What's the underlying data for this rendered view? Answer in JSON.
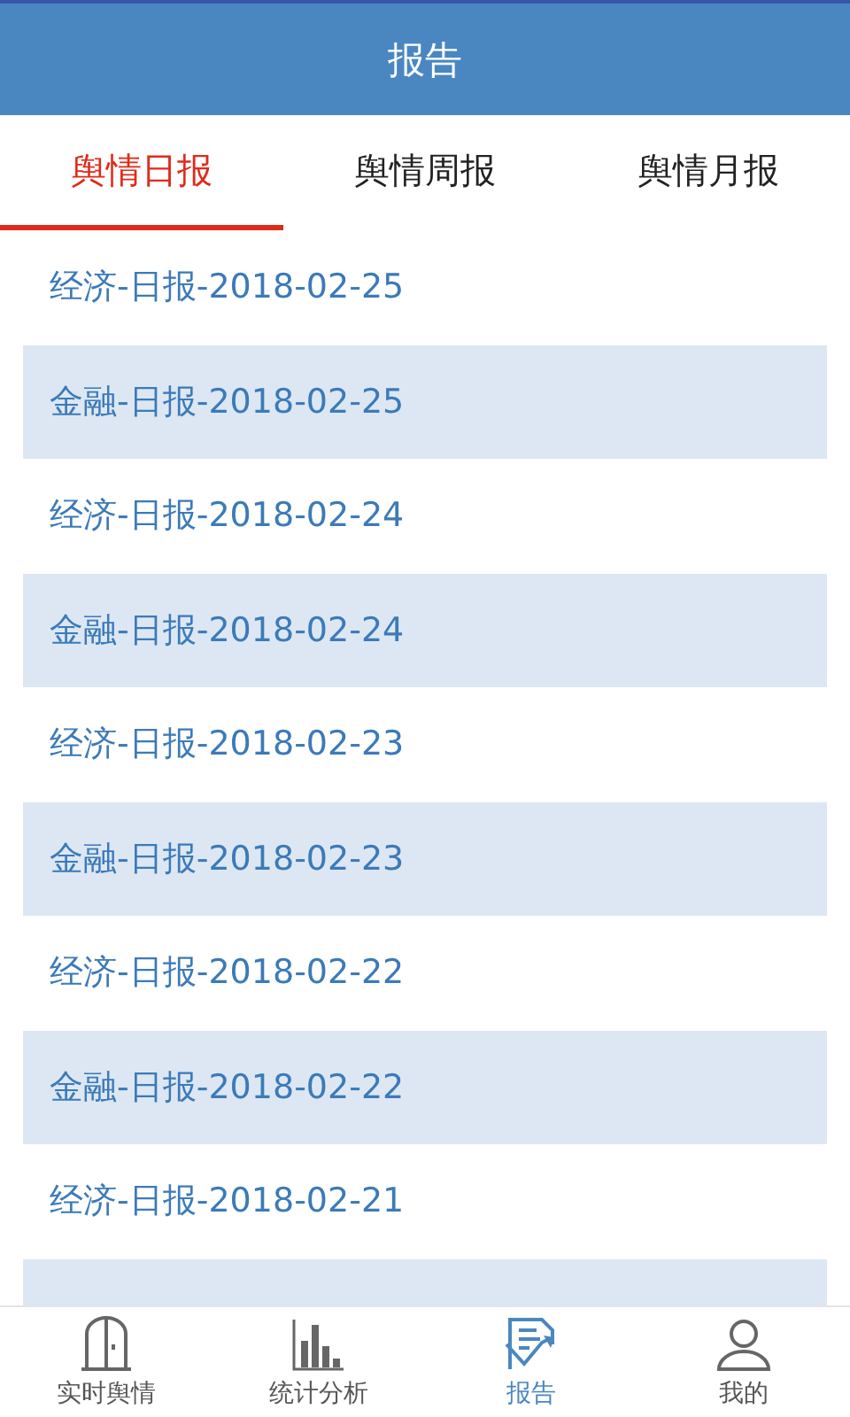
{
  "header": {
    "title": "报告"
  },
  "tabs": [
    {
      "label": "舆情日报",
      "selected": true
    },
    {
      "label": "舆情周报",
      "selected": false
    },
    {
      "label": "舆情月报",
      "selected": false
    }
  ],
  "reports": [
    {
      "label": "经济-日报-2018-02-25",
      "shaded": false
    },
    {
      "label": "金融-日报-2018-02-25",
      "shaded": true
    },
    {
      "label": "经济-日报-2018-02-24",
      "shaded": false
    },
    {
      "label": "金融-日报-2018-02-24",
      "shaded": true
    },
    {
      "label": "经济-日报-2018-02-23",
      "shaded": false
    },
    {
      "label": "金融-日报-2018-02-23",
      "shaded": true
    },
    {
      "label": "经济-日报-2018-02-22",
      "shaded": false
    },
    {
      "label": "金融-日报-2018-02-22",
      "shaded": true
    },
    {
      "label": "经济-日报-2018-02-21",
      "shaded": false
    },
    {
      "shaded": true
    }
  ],
  "bottom_nav": [
    {
      "label": "实时舆情",
      "kind": "door",
      "selected": false
    },
    {
      "label": "统计分析",
      "kind": "chart",
      "selected": false
    },
    {
      "label": "报告",
      "kind": "report",
      "selected": true
    },
    {
      "label": "我的",
      "kind": "person",
      "selected": false
    }
  ]
}
